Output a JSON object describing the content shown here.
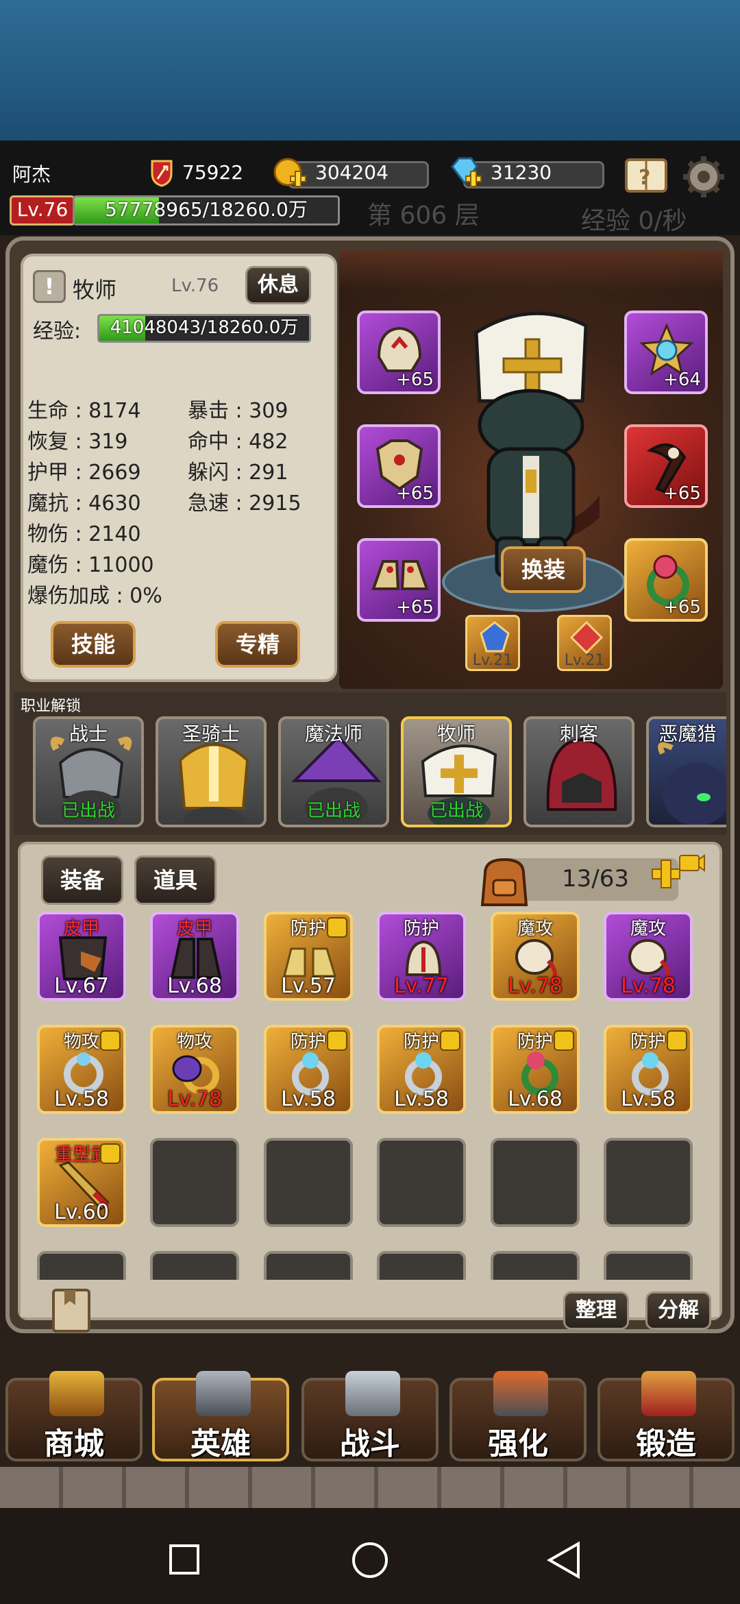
{
  "header": {
    "player_name": "阿杰",
    "power": "75922",
    "gold": "304204",
    "diamonds": "31230",
    "level": "Lv.76",
    "player_exp": "57778965/18260.0万",
    "floor": "第 606 层",
    "exp_rate": "经验 0/秒"
  },
  "hero": {
    "class_name": "牧师",
    "level": "Lv.76",
    "rest_button": "休息",
    "exp_label": "经验:",
    "exp_value": "41048043/18260.0万",
    "stats_left": [
      {
        "text": "生命 : 8174"
      },
      {
        "text": "恢复 : 319"
      },
      {
        "text": "护甲 : 2669"
      },
      {
        "text": "魔抗 : 4630"
      },
      {
        "text": "物伤 : 2140"
      },
      {
        "text": "魔伤 : 11000"
      },
      {
        "text": "爆伤加成 : 0%"
      }
    ],
    "stats_right": [
      {
        "text": "暴击 : 309"
      },
      {
        "text": "命中 : 482"
      },
      {
        "text": "躲闪 : 291"
      },
      {
        "text": "急速 : 2915"
      }
    ],
    "skill_button": "技能",
    "specialize_button": "专精",
    "change_outfit_button": "换装",
    "equipment": {
      "helmet": "+65",
      "armor": "+65",
      "boots": "+65",
      "amulet": "+64",
      "weapon": "+65",
      "ring": "+65"
    },
    "gems": [
      "Lv.21",
      "Lv.21"
    ]
  },
  "classes": {
    "title": "职业解锁",
    "items": [
      {
        "label": "战士",
        "status": "已出战"
      },
      {
        "label": "圣骑士",
        "status": ""
      },
      {
        "label": "魔法师",
        "status": "已出战"
      },
      {
        "label": "牧师",
        "status": "已出战"
      },
      {
        "label": "刺客",
        "status": ""
      },
      {
        "label": "恶魔猎",
        "status": ""
      }
    ]
  },
  "inventory": {
    "tab_equipment": "装备",
    "tab_items": "道具",
    "capacity": "13/63",
    "rows": [
      [
        {
          "tag": "皮甲",
          "lv": "Lv.67"
        },
        {
          "tag": "皮甲",
          "lv": "Lv.68"
        },
        {
          "tag": "防护",
          "lv": "Lv.57"
        },
        {
          "tag": "防护",
          "lv": "Lv.77"
        },
        {
          "tag": "魔攻",
          "lv": "Lv.78"
        },
        {
          "tag": "魔攻",
          "lv": "Lv.78"
        }
      ],
      [
        {
          "tag": "物攻",
          "lv": "Lv.58"
        },
        {
          "tag": "物攻",
          "lv": "Lv.78"
        },
        {
          "tag": "防护",
          "lv": "Lv.58"
        },
        {
          "tag": "防护",
          "lv": "Lv.58"
        },
        {
          "tag": "防护",
          "lv": "Lv.68"
        },
        {
          "tag": "防护",
          "lv": "Lv.58"
        }
      ],
      [
        {
          "tag": "重型武",
          "lv": "Lv.60"
        }
      ]
    ],
    "sort_button": "整理",
    "decompose_button": "分解"
  },
  "nav": {
    "shop": "商城",
    "hero": "英雄",
    "battle": "战斗",
    "enhance": "强化",
    "forge": "锻造"
  },
  "colors": {
    "sky": "#2e6c95",
    "rarity_purple": "#b24cd8",
    "rarity_gold": "#efaf3a",
    "rarity_red": "#e03434",
    "deployed_green": "#2bd62b",
    "high_level_red": "#ff2020"
  }
}
